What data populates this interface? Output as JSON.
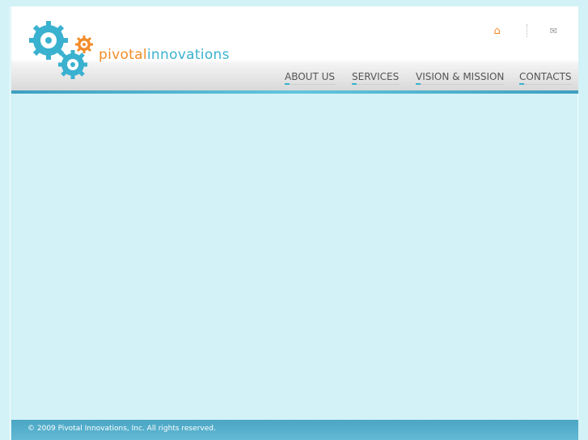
{
  "brand": {
    "part1": "pivotal",
    "part2": "innovations"
  },
  "top_icons": [
    "home-icon",
    "mail-icon"
  ],
  "nav": [
    {
      "label": "ABOUT US"
    },
    {
      "label": "SERVICES"
    },
    {
      "label": "VISION & MISSION"
    },
    {
      "label": "CONTACTS"
    }
  ],
  "footer": {
    "text": "©  2009 Pivotal Innovations, Inc. All rights reserved."
  },
  "colors": {
    "orange": "#f28c28",
    "blue": "#3ab1cf",
    "background": "#d3f2f7"
  }
}
